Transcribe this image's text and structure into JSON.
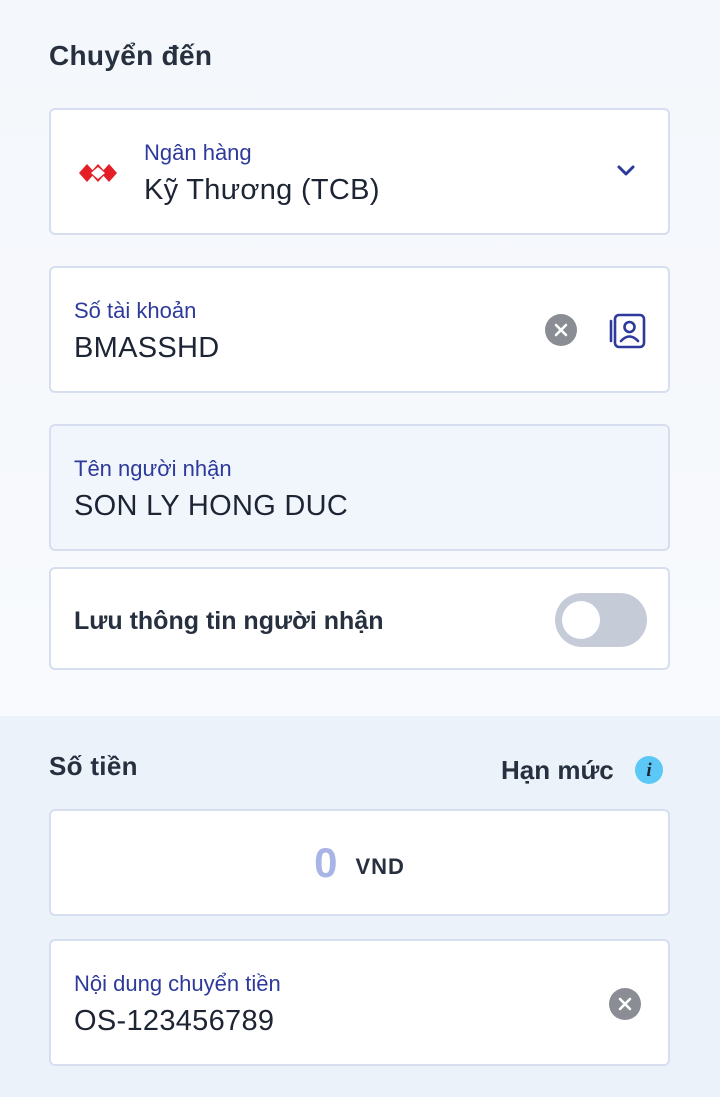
{
  "transfer_to": {
    "title": "Chuyển đến",
    "bank": {
      "label": "Ngân hàng",
      "value": "Kỹ Thương (TCB)",
      "icon": "techcombank-logo-icon",
      "brand_color": "#e41e26"
    },
    "account": {
      "label": "Số tài khoản",
      "value": "BMASSHD"
    },
    "recipient": {
      "label": "Tên người nhận",
      "value": "SON LY HONG DUC"
    },
    "save_recipient": {
      "label": "Lưu thông tin người nhận",
      "enabled": false
    }
  },
  "amount": {
    "title": "Số tiền",
    "limit_label": "Hạn mức",
    "value": "0",
    "currency": "VND"
  },
  "memo": {
    "label": "Nội dung chuyển tiền",
    "value": "OS-123456789"
  },
  "colors": {
    "accent": "#2d3a9b",
    "info": "#5bc8f5",
    "placeholder_amount": "#a9b4e6"
  }
}
